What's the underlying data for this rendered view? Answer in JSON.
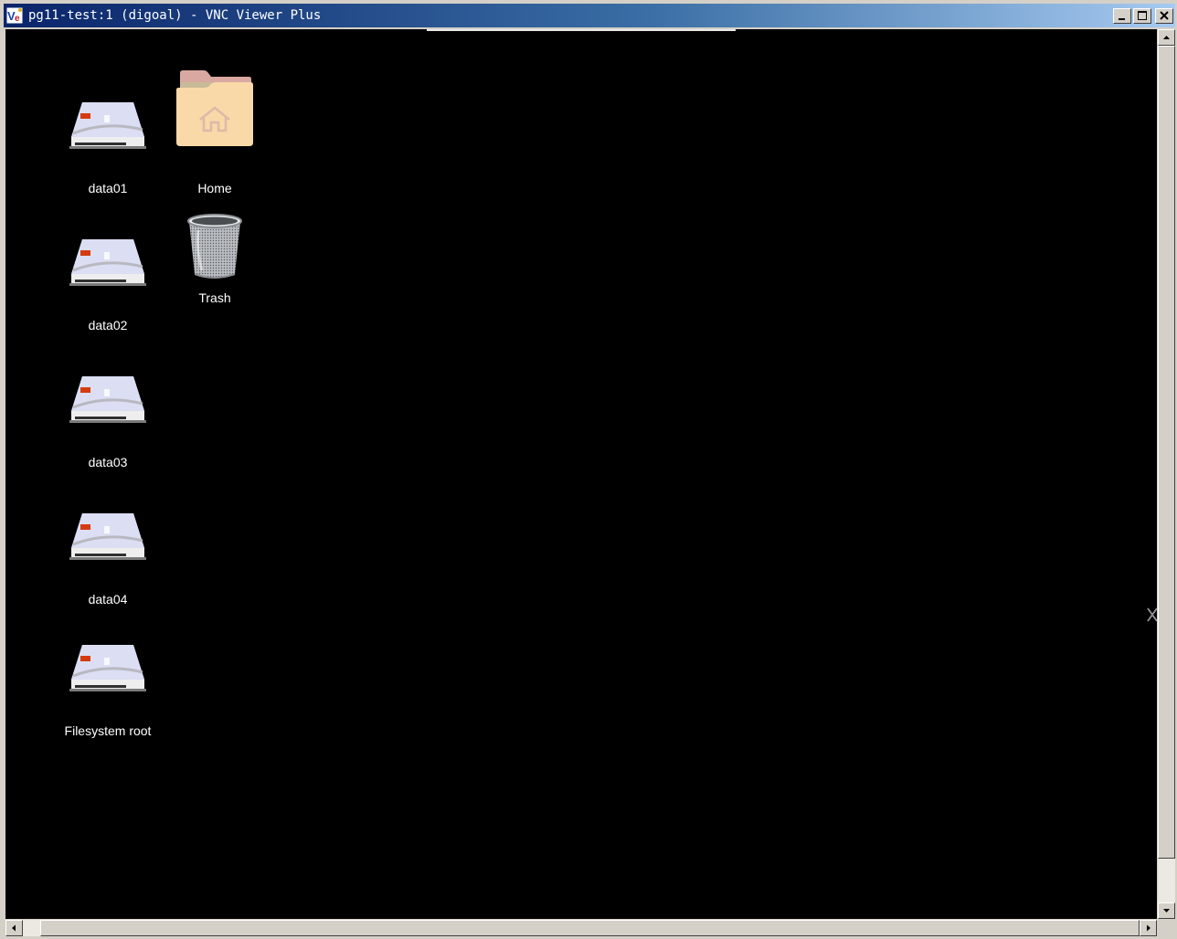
{
  "window": {
    "title": "pg11-test:1 (digoal) - VNC Viewer Plus",
    "app_icon": "vnc-viewer-icon",
    "controls": [
      "minimize",
      "maximize",
      "close"
    ]
  },
  "desktop": {
    "background_color": "#000000",
    "icons": [
      {
        "label": "data01",
        "icon": "drive-icon"
      },
      {
        "label": "data02",
        "icon": "drive-icon"
      },
      {
        "label": "data03",
        "icon": "drive-icon"
      },
      {
        "label": "data04",
        "icon": "drive-icon"
      },
      {
        "label": "Filesystem root",
        "icon": "drive-icon"
      },
      {
        "label": "Home",
        "icon": "home-folder-icon"
      },
      {
        "label": "Trash",
        "icon": "trash-icon"
      }
    ]
  },
  "colors": {
    "titlebar_start": "#0a246a",
    "titlebar_end": "#a6caf0",
    "folder": "#f9d9a8"
  }
}
